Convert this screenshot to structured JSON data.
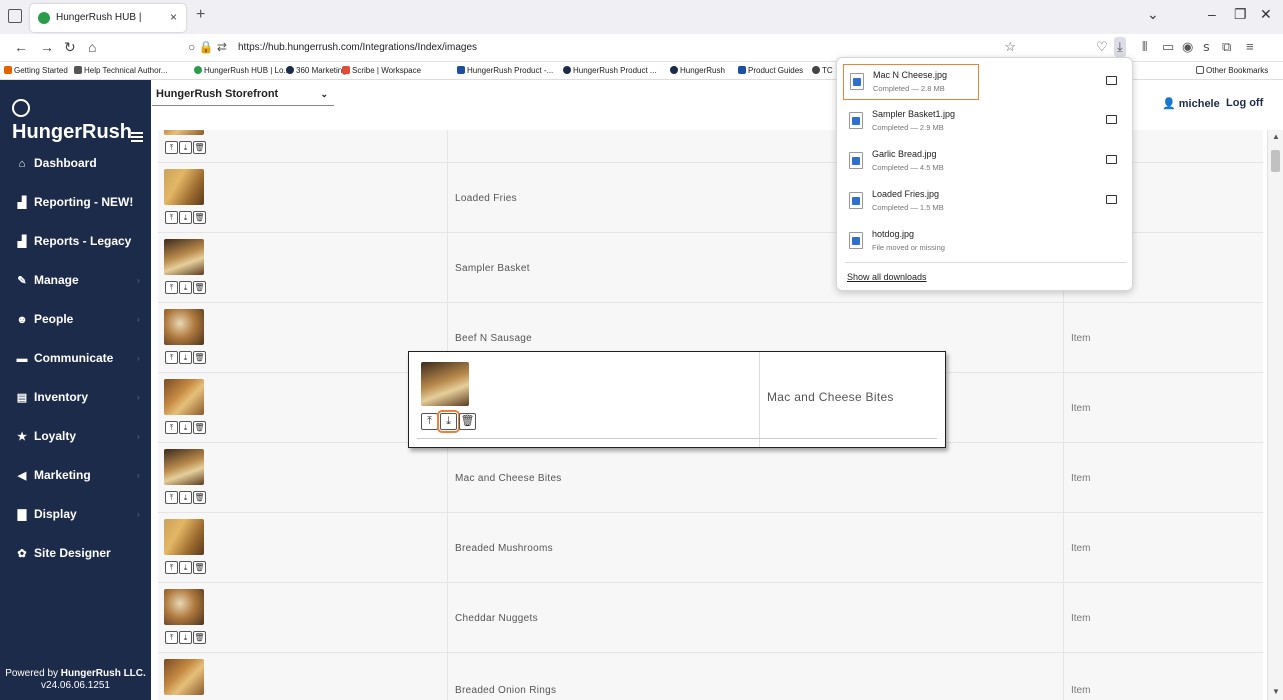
{
  "browser": {
    "tab_title": "HungerRush HUB |",
    "tab_close": "×",
    "new_tab": "+",
    "url": "https://hub.hungerrush.com/Integrations/Index/images",
    "bookmarks": [
      {
        "label": "Getting Started",
        "color": "#e66000"
      },
      {
        "label": "Help Technical Author...",
        "color": "#555555"
      },
      {
        "label": "HungerRush HUB | Lo...",
        "color": "#2a9d4b"
      },
      {
        "label": "360 Marketing",
        "color": "#1d2b4a"
      },
      {
        "label": "Scribe | Workspace",
        "color": "#e04b3a"
      },
      {
        "label": "HungerRush Product -...",
        "color": "#1d4fa0"
      },
      {
        "label": "HungerRush Product ...",
        "color": "#1d2b4a"
      },
      {
        "label": "HungerRush",
        "color": "#1d2b4a"
      },
      {
        "label": "Product Guides",
        "color": "#1d4fa0"
      },
      {
        "label": "TC",
        "color": "#444444"
      }
    ],
    "other_bookmarks": "Other Bookmarks"
  },
  "header": {
    "store": "HungerRush Storefront",
    "user": "michele",
    "logoff": "Log off"
  },
  "sidebar": {
    "logo": "HungerRush",
    "items": [
      {
        "label": "Dashboard",
        "icon": "home-icon"
      },
      {
        "label": "Reporting - NEW!",
        "icon": "bar-chart-icon"
      },
      {
        "label": "Reports - Legacy",
        "icon": "bar-chart-icon"
      },
      {
        "label": "Manage",
        "icon": "wrench-icon"
      },
      {
        "label": "People",
        "icon": "people-icon"
      },
      {
        "label": "Communicate",
        "icon": "chat-icon"
      },
      {
        "label": "Inventory",
        "icon": "clipboard-icon"
      },
      {
        "label": "Loyalty",
        "icon": "star-icon"
      },
      {
        "label": "Marketing",
        "icon": "megaphone-icon"
      },
      {
        "label": "Display",
        "icon": "truck-icon"
      },
      {
        "label": "Site Designer",
        "icon": "palette-icon"
      }
    ],
    "powered_by_prefix": "Powered by ",
    "powered_by_brand": "HungerRush LLC.",
    "version": "v24.06.06.1251"
  },
  "table": {
    "rows": [
      {
        "name": "",
        "type": ""
      },
      {
        "name": "Loaded Fries",
        "type": ""
      },
      {
        "name": "Sampler Basket",
        "type": ""
      },
      {
        "name": "Beef N Sausage",
        "type": "Item"
      },
      {
        "name": "",
        "type": "Item"
      },
      {
        "name": "Mac and Cheese Bites",
        "type": "Item"
      },
      {
        "name": "Breaded Mushrooms",
        "type": "Item"
      },
      {
        "name": "Cheddar Nuggets",
        "type": "Item"
      },
      {
        "name": "Breaded Onion Rings",
        "type": "Item"
      }
    ]
  },
  "callout": {
    "name": "Mac and Cheese Bites"
  },
  "downloads": {
    "items": [
      {
        "name": "Mac N Cheese.jpg",
        "status": "Completed — 2.8 MB"
      },
      {
        "name": "Sampler Basket1.jpg",
        "status": "Completed — 2.9 MB"
      },
      {
        "name": "Garlic Bread.jpg",
        "status": "Completed — 4.5 MB"
      },
      {
        "name": "Loaded Fries.jpg",
        "status": "Completed — 1.5 MB"
      },
      {
        "name": "hotdog.jpg",
        "status": "File moved or missing"
      }
    ],
    "show_all": "Show all downloads"
  },
  "colors": {
    "sidebar_bg": "#1d2b4a",
    "highlight": "#e8833a",
    "row_bg": "#f7f7f7"
  }
}
